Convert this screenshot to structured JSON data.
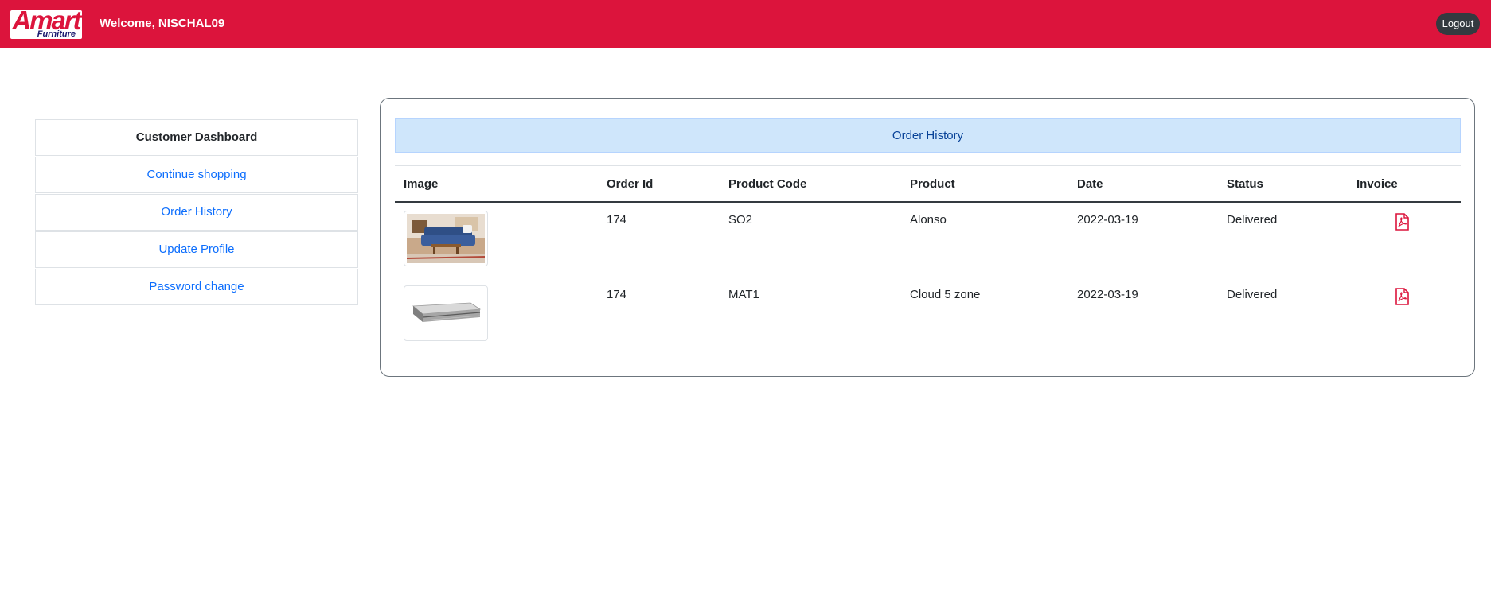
{
  "header": {
    "logo_text": "Amart",
    "logo_sub": "Furniture",
    "welcome": "Welcome, NISCHAL09",
    "logout_label": "Logout",
    "brand_color": "#dc143c"
  },
  "sidebar": {
    "items": [
      {
        "label": "Customer Dashboard"
      },
      {
        "label": "Continue shopping"
      },
      {
        "label": "Order History"
      },
      {
        "label": "Update Profile"
      },
      {
        "label": "Password change"
      }
    ]
  },
  "main": {
    "title": "Order History",
    "columns": [
      "Image",
      "Order Id",
      "Product Code",
      "Product",
      "Date",
      "Status",
      "Invoice"
    ],
    "rows": [
      {
        "image": "sofa-living-room-thumbnail",
        "order_id": "174",
        "product_code": "SO2",
        "product": "Alonso",
        "date": "2022-03-19",
        "status": "Delivered",
        "invoice_icon": "pdf-icon"
      },
      {
        "image": "mattress-thumbnail",
        "order_id": "174",
        "product_code": "MAT1",
        "product": "Cloud 5 zone",
        "date": "2022-03-19",
        "status": "Delivered",
        "invoice_icon": "pdf-icon"
      }
    ]
  }
}
